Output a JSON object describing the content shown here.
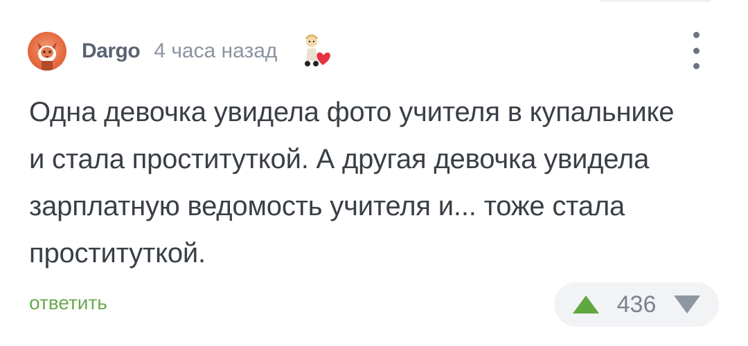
{
  "comment": {
    "author": "Dargo",
    "time": "4 часа назад",
    "text": "Одна девочка увидела фото учителя в купальнике и стала проституткой. А другая девочка увидела зарплатную ведомость учителя и... тоже стала проституткой.",
    "reply_label": "ответить",
    "score": "436"
  },
  "colors": {
    "reply": "#6aa84f",
    "upvote": "#5fa840",
    "downvote": "#8e96a1",
    "avatar": "#e5683f"
  },
  "icons": {
    "avatar": "fox-avatar",
    "badge": "doll-heart-badge",
    "menu": "kebab-menu-icon",
    "up": "triangle-up-icon",
    "down": "triangle-down-icon"
  }
}
